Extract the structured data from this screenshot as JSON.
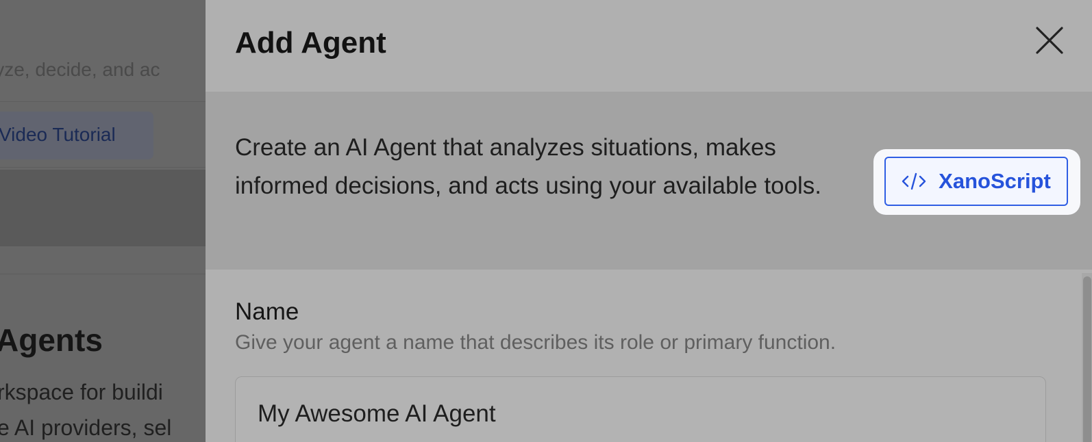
{
  "background": {
    "subtitle": "lyze, decide, and ac",
    "video_button_label": "Video Tutorial",
    "heading": "Agents",
    "paragraph_lines": [
      "rkspace for buildi",
      "e AI providers, sel"
    ]
  },
  "dialog": {
    "title": "Add Agent",
    "close_icon": "close-icon",
    "intro": "Create an AI Agent that analyzes situations, makes informed decisions, and acts using your available tools.",
    "xanoscript_button": {
      "label": "XanoScript",
      "icon": "code-icon",
      "accent": "#2653db"
    },
    "name_field": {
      "label": "Name",
      "help": "Give your agent a name that describes its role or primary function.",
      "placeholder": "My Awesome AI Agent"
    }
  }
}
